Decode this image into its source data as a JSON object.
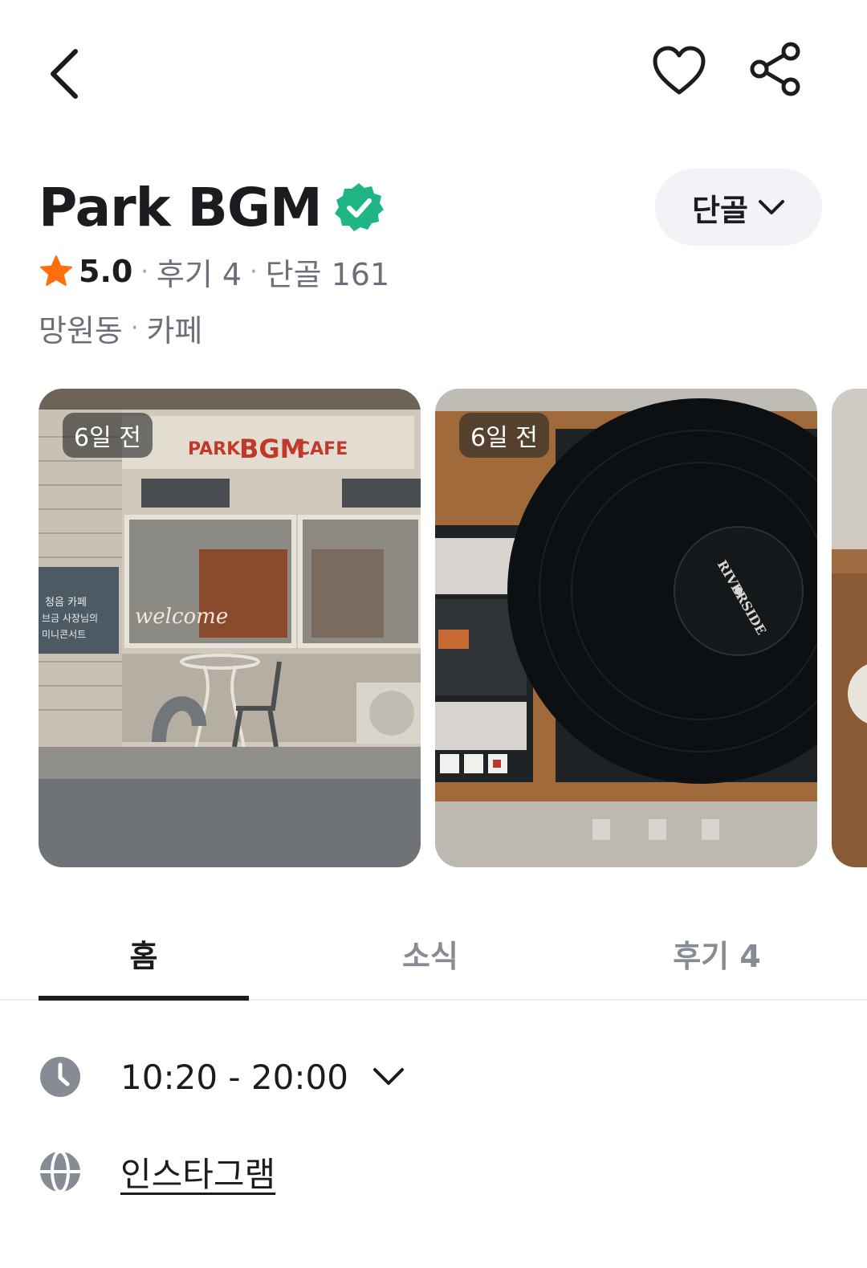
{
  "header": {
    "back_icon": "chevron-left-icon",
    "favorite_icon": "heart-icon",
    "share_icon": "share-icon"
  },
  "place": {
    "name": "Park BGM",
    "verified_icon": "verified-badge-icon",
    "rating": "5.0",
    "reviews": "후기 4",
    "regulars": "단골 161",
    "area": "망원동",
    "category": "카페"
  },
  "regular_button": {
    "label": "단골",
    "icon": "chevron-down-icon"
  },
  "photos": [
    {
      "badge": "6일 전",
      "sign_text": "PARK BGM CAFE"
    },
    {
      "badge": "6일 전"
    },
    {
      "badge": ""
    }
  ],
  "tabs": [
    {
      "label": "홈",
      "active": true
    },
    {
      "label": "소식",
      "active": false
    },
    {
      "label": "후기 4",
      "active": false
    }
  ],
  "info": {
    "hours": "10:20 - 20:00",
    "hours_icon": "clock-icon",
    "website": "인스타그램",
    "website_icon": "globe-icon"
  },
  "colors": {
    "accent_green": "#1fb585",
    "star_orange": "#ff6f0f",
    "text_primary": "#1a1c20",
    "text_secondary": "#6b6f78"
  }
}
